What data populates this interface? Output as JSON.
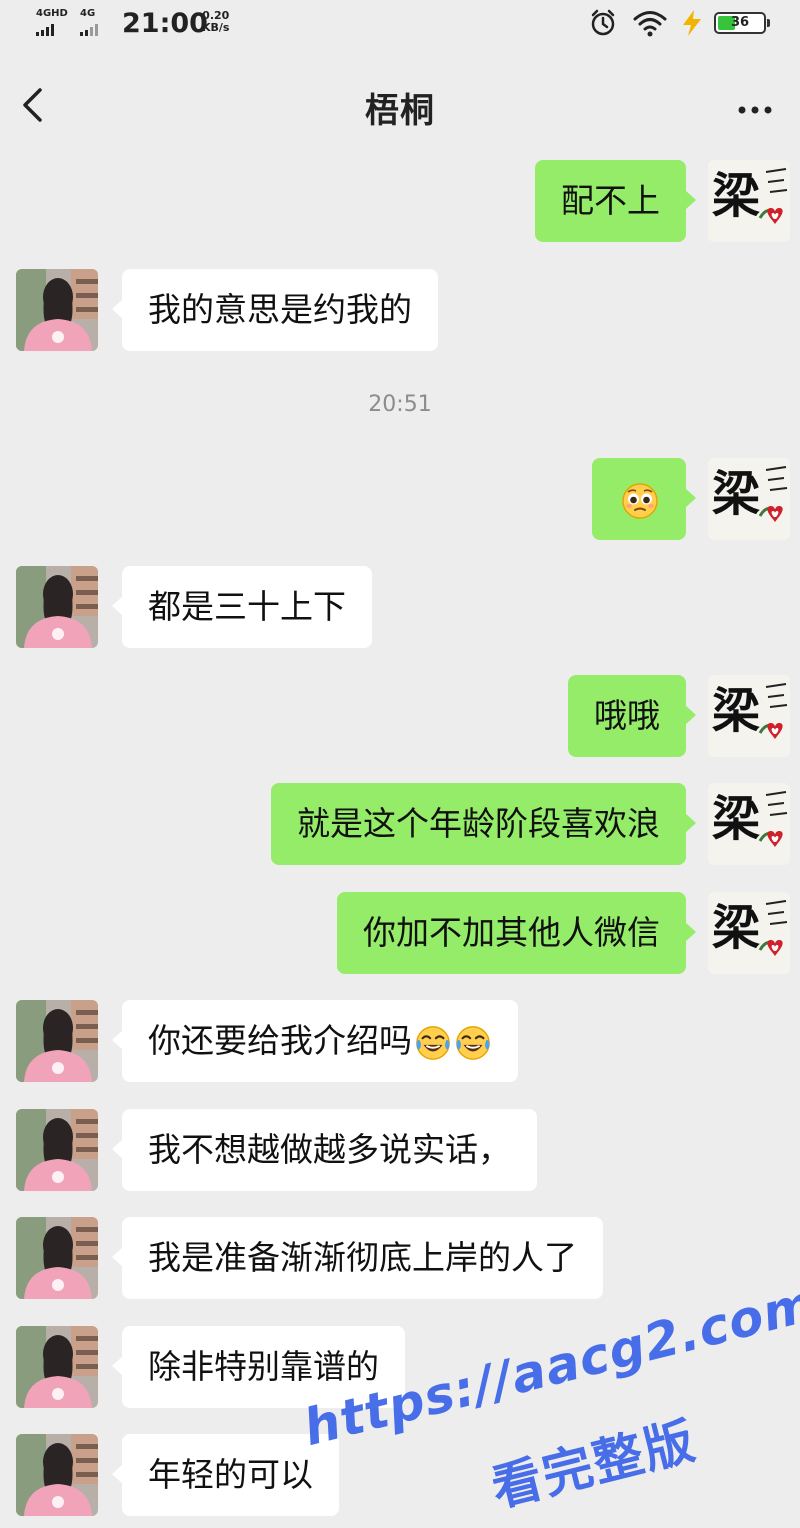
{
  "status_bar": {
    "sim1_label": "4GHD",
    "sim2_label": "4G",
    "time": "21:00",
    "net_speed_value": "0.20",
    "net_speed_unit": "KB/s",
    "battery_level": "36",
    "alarm_icon": "alarm-clock-icon",
    "wifi_icon": "wifi-icon",
    "charging_icon": "lightning-icon"
  },
  "header": {
    "title": "梧桐",
    "back_icon": "chevron-left-icon",
    "more_icon": "more-dots-icon"
  },
  "colors": {
    "background": "#ededed",
    "sent_bubble": "#95ec69",
    "received_bubble": "#ffffff",
    "watermark": "#3a63e8"
  },
  "timestamp": "20:51",
  "messages": [
    {
      "side": "right",
      "text": "配不上"
    },
    {
      "side": "left",
      "text": "我的意思是约我的"
    },
    {
      "side": "right",
      "emoji": "pleading-face-emoji"
    },
    {
      "side": "left",
      "text": "都是三十上下"
    },
    {
      "side": "right",
      "text": "哦哦"
    },
    {
      "side": "right",
      "text": "就是这个年龄阶段喜欢浪"
    },
    {
      "side": "right",
      "text": "你加不加其他人微信"
    },
    {
      "side": "left",
      "text": "你还要给我介绍吗",
      "emoji": "laughing-crying-emoji"
    },
    {
      "side": "left",
      "text": "我不想越做越多说实话，"
    },
    {
      "side": "left",
      "text": "我是准备渐渐彻底上岸的人了"
    },
    {
      "side": "left",
      "text": "除非特别靠谱的"
    },
    {
      "side": "left",
      "text": "年轻的可以"
    }
  ],
  "watermark": {
    "url": "https://aacg2.com",
    "subtitle": "看完整版"
  }
}
